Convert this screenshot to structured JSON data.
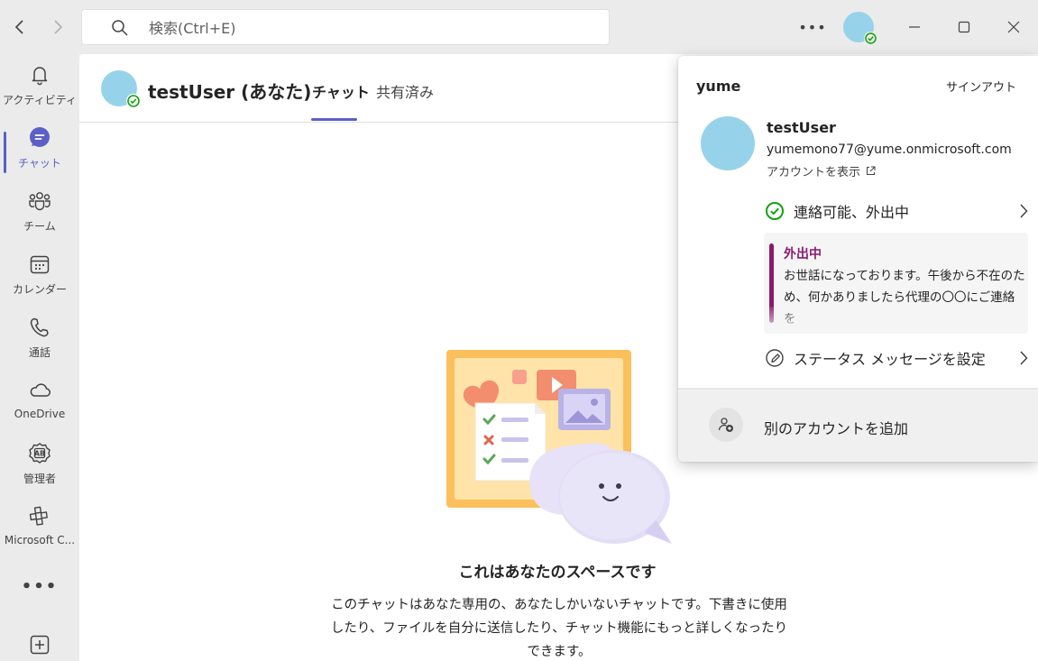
{
  "search": {
    "placeholder": "検索(Ctrl+E)"
  },
  "titlebar": {
    "more": "•••"
  },
  "rail": {
    "items": [
      {
        "label": "アクティビティ"
      },
      {
        "label": "チャット"
      },
      {
        "label": "チーム"
      },
      {
        "label": "カレンダー"
      },
      {
        "label": "通話"
      },
      {
        "label": "OneDrive"
      },
      {
        "label": "管理者"
      },
      {
        "label": "Microsoft C..."
      }
    ],
    "more": "•••"
  },
  "chat": {
    "name": "testUser (あなた)",
    "tabs": [
      {
        "label": "チャット"
      },
      {
        "label": "共有済み"
      }
    ],
    "empty_title": "これはあなたのスペースです",
    "empty_desc": "このチャットはあなた専用の、あなたしかいないチャットです。下書きに使用したり、ファイルを自分に送信したり、チャット機能にもっと詳しくなったりできます。"
  },
  "flyout": {
    "tenant": "yume",
    "signout": "サインアウト",
    "name": "testUser",
    "email": "yumemono77@yume.onmicrosoft.com",
    "view_account": "アカウントを表示",
    "status": "連絡可能、外出中",
    "ooo_title": "外出中",
    "ooo_message": "お世話になっております。午後から不在のため、何かありましたら代理の〇〇にご連絡を",
    "set_status_message": "ステータス メッセージを設定",
    "add_account": "別のアカウントを追加"
  },
  "colors": {
    "accent": "#5b5fc7",
    "presence": "#13a10e",
    "ooo": "#8b1a6b",
    "avatar": "#96d3ea"
  }
}
